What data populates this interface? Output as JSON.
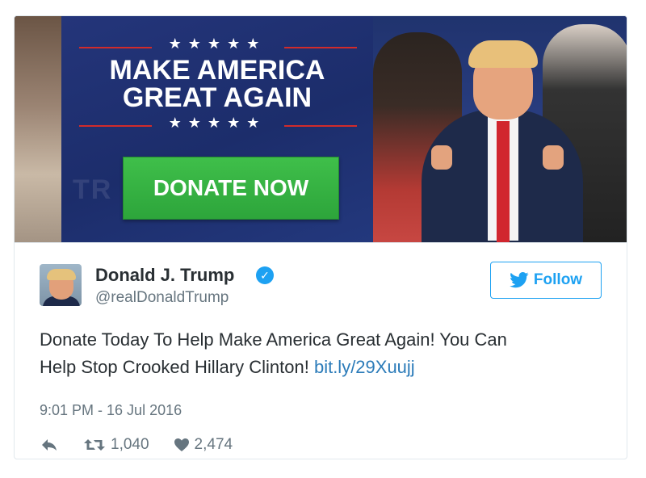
{
  "banner": {
    "stars": "★★★★★",
    "headline_line1": "MAKE AMERICA",
    "headline_line2": "GREAT AGAIN",
    "donate_label": "DONATE NOW",
    "ghost_text": "TR",
    "colors": {
      "blue": "#1c2d6b",
      "green": "#2da53b",
      "red": "#d12b2b"
    }
  },
  "tweet": {
    "author_name": "Donald J. Trump",
    "author_handle": "@realDonaldTrump",
    "verified_mark": "✓",
    "follow_label": "Follow",
    "text_line1": "Donate Today To Help Make America Great Again! You Can",
    "text_line2": "Help Stop Crooked Hillary Clinton!",
    "link_text": "bit.ly/29Xuujj",
    "timestamp": "9:01 PM - 16 Jul 2016",
    "retweet_count": "1,040",
    "like_count": "2,474",
    "icons": [
      "reply-icon",
      "retweet-icon",
      "heart-icon",
      "twitter-bird-icon",
      "verified-badge-icon"
    ],
    "colors": {
      "link": "#2b7bb9",
      "accent": "#1da1f2",
      "muted": "#66757f"
    }
  }
}
